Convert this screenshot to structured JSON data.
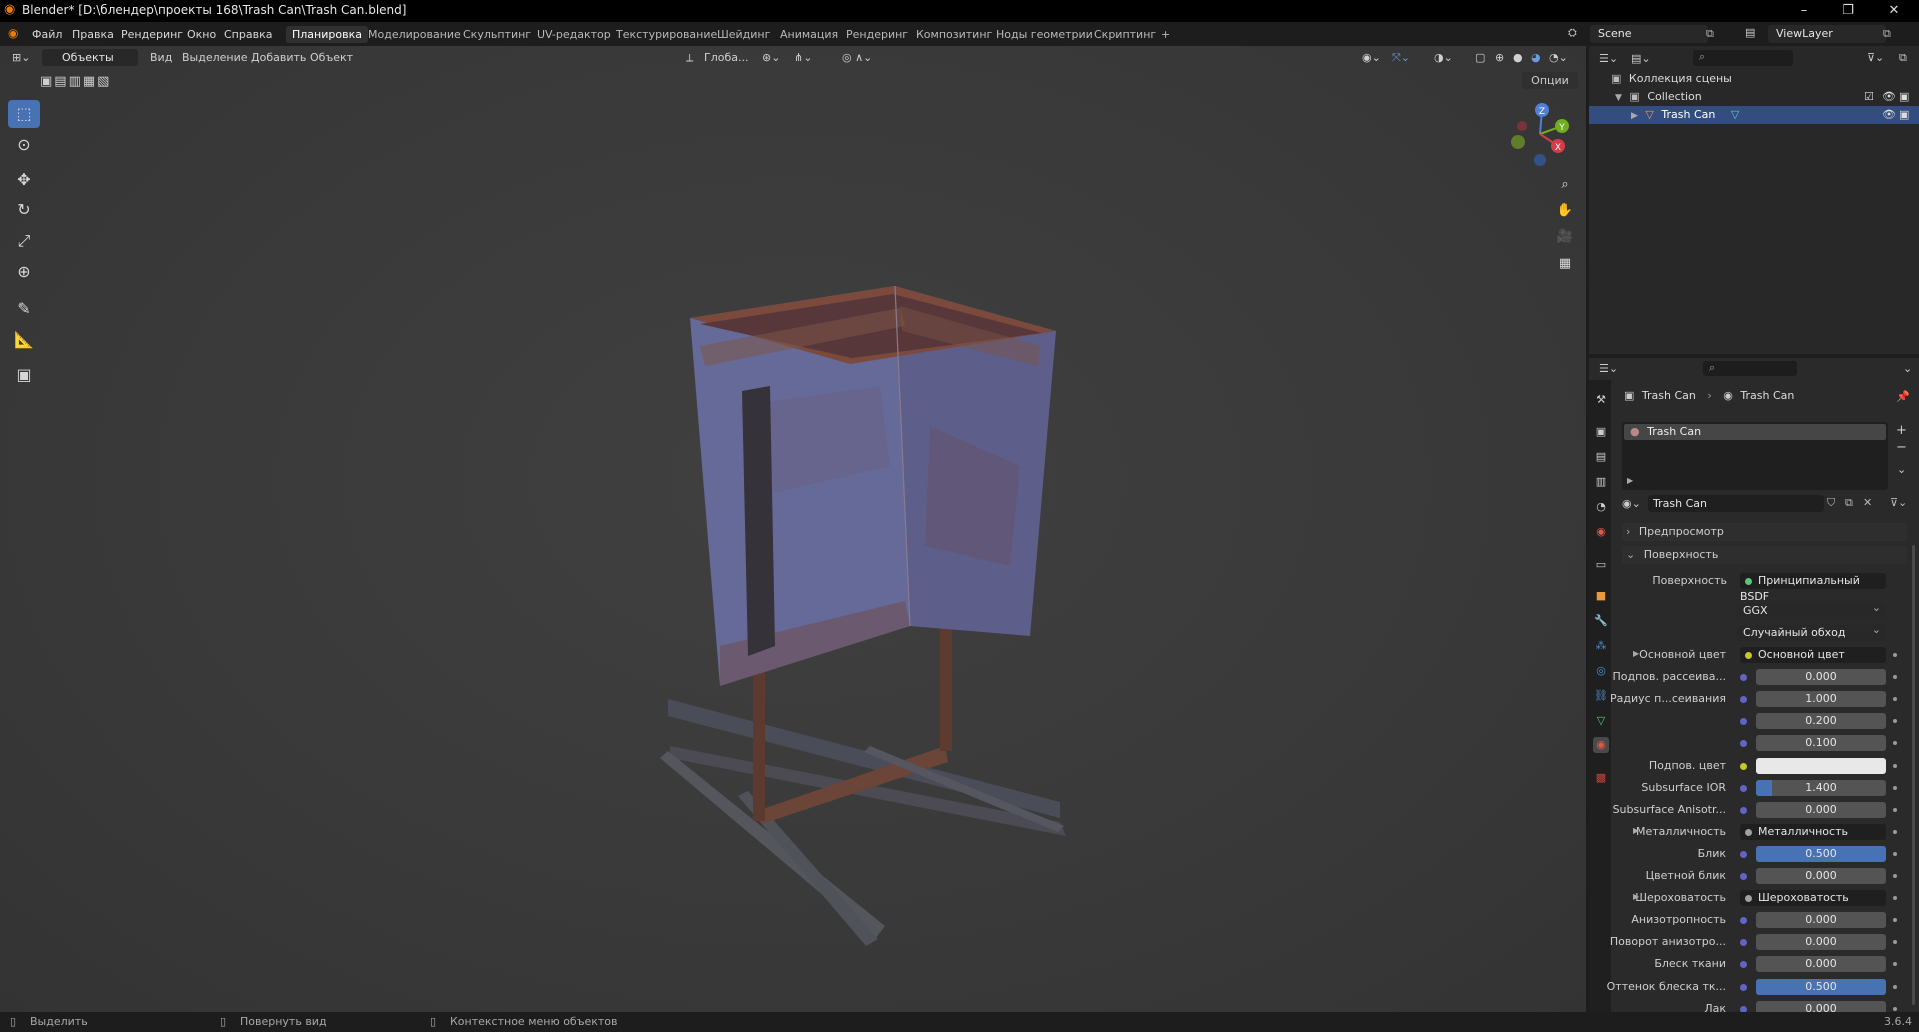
{
  "window": {
    "title": "Blender* [D:\\блендер\\проекты 168\\Trash Can\\Trash Can.blend]",
    "controls": {
      "minimize": "–",
      "maximize": "❐",
      "close": "✕"
    }
  },
  "menu": [
    "Файл",
    "Правка",
    "Рендеринг",
    "Окно",
    "Справка"
  ],
  "workspaces": [
    "Планировка",
    "Моделирование",
    "Скульптинг",
    "UV-редактор",
    "Текстурирование",
    "Шейдинг",
    "Анимация",
    "Рендеринг",
    "Композитинг",
    "Ноды геометрии",
    "Скриптинг",
    "+"
  ],
  "scene": {
    "name": "Scene",
    "view_layer": "ViewLayer"
  },
  "viewport_header": {
    "mode": "Объекты",
    "menus": [
      "Вид",
      "Выделение",
      "Добавить",
      "Объект"
    ],
    "transform": "Глоба...",
    "options": "Опции"
  },
  "gizmo": {
    "x": "X",
    "y": "Y",
    "z": "Z"
  },
  "outliner": {
    "root": "Коллекция сцены",
    "collection": "Collection",
    "object": "Trash Can"
  },
  "properties": {
    "breadcrumb": [
      "Trash Can",
      "Trash Can"
    ],
    "slot": "Trash Can",
    "material": "Trash Can",
    "sections": {
      "preview": "Предпросмотр",
      "surface": "Поверхность"
    },
    "surface_label": "Поверхность",
    "surface_value": "Принципиальный BSDF",
    "distribution": "GGX",
    "subsurface_method": "Случайный обход",
    "rows": [
      {
        "label": "Основной цвет",
        "type": "link",
        "value": "Основной цвет",
        "sock": "#c7c729",
        "expand": true
      },
      {
        "label": "Подпов. рассеива...",
        "type": "num",
        "value": "0.000",
        "fill": 0
      },
      {
        "label": "Радиус п...сеивания",
        "type": "num",
        "value": "1.000",
        "fill": 0
      },
      {
        "label": "",
        "type": "num",
        "value": "0.200",
        "fill": 0
      },
      {
        "label": "",
        "type": "num",
        "value": "0.100",
        "fill": 0
      },
      {
        "label": "Подпов. цвет",
        "type": "color",
        "value": "#e8e8e8",
        "sock": "#c7c729"
      },
      {
        "label": "Subsurface IOR",
        "type": "num",
        "value": "1.400",
        "fill": 0.12
      },
      {
        "label": "Subsurface Anisotr...",
        "type": "num",
        "value": "0.000",
        "fill": 0
      },
      {
        "label": "Металличность",
        "type": "link",
        "value": "Металличность",
        "sock": "#a1a1a1",
        "expand": true
      },
      {
        "label": "Блик",
        "type": "num",
        "value": "0.500",
        "fill": 1
      },
      {
        "label": "Цветной блик",
        "type": "num",
        "value": "0.000",
        "fill": 0
      },
      {
        "label": "Шероховатость",
        "type": "link",
        "value": "Шероховатость",
        "sock": "#a1a1a1",
        "expand": true
      },
      {
        "label": "Анизотропность",
        "type": "num",
        "value": "0.000",
        "fill": 0
      },
      {
        "label": "Поворот анизотро...",
        "type": "num",
        "value": "0.000",
        "fill": 0
      },
      {
        "label": "Блеск ткани",
        "type": "num",
        "value": "0.000",
        "fill": 0
      },
      {
        "label": "Оттенок блеска тк...",
        "type": "num",
        "value": "0.500",
        "fill": 1
      },
      {
        "label": "Лак",
        "type": "num",
        "value": "0.000",
        "fill": 0
      }
    ]
  },
  "status": {
    "select": "Выделить",
    "rotate": "Повернуть вид",
    "context": "Контекстное меню объектов",
    "version": "3.6.4"
  }
}
